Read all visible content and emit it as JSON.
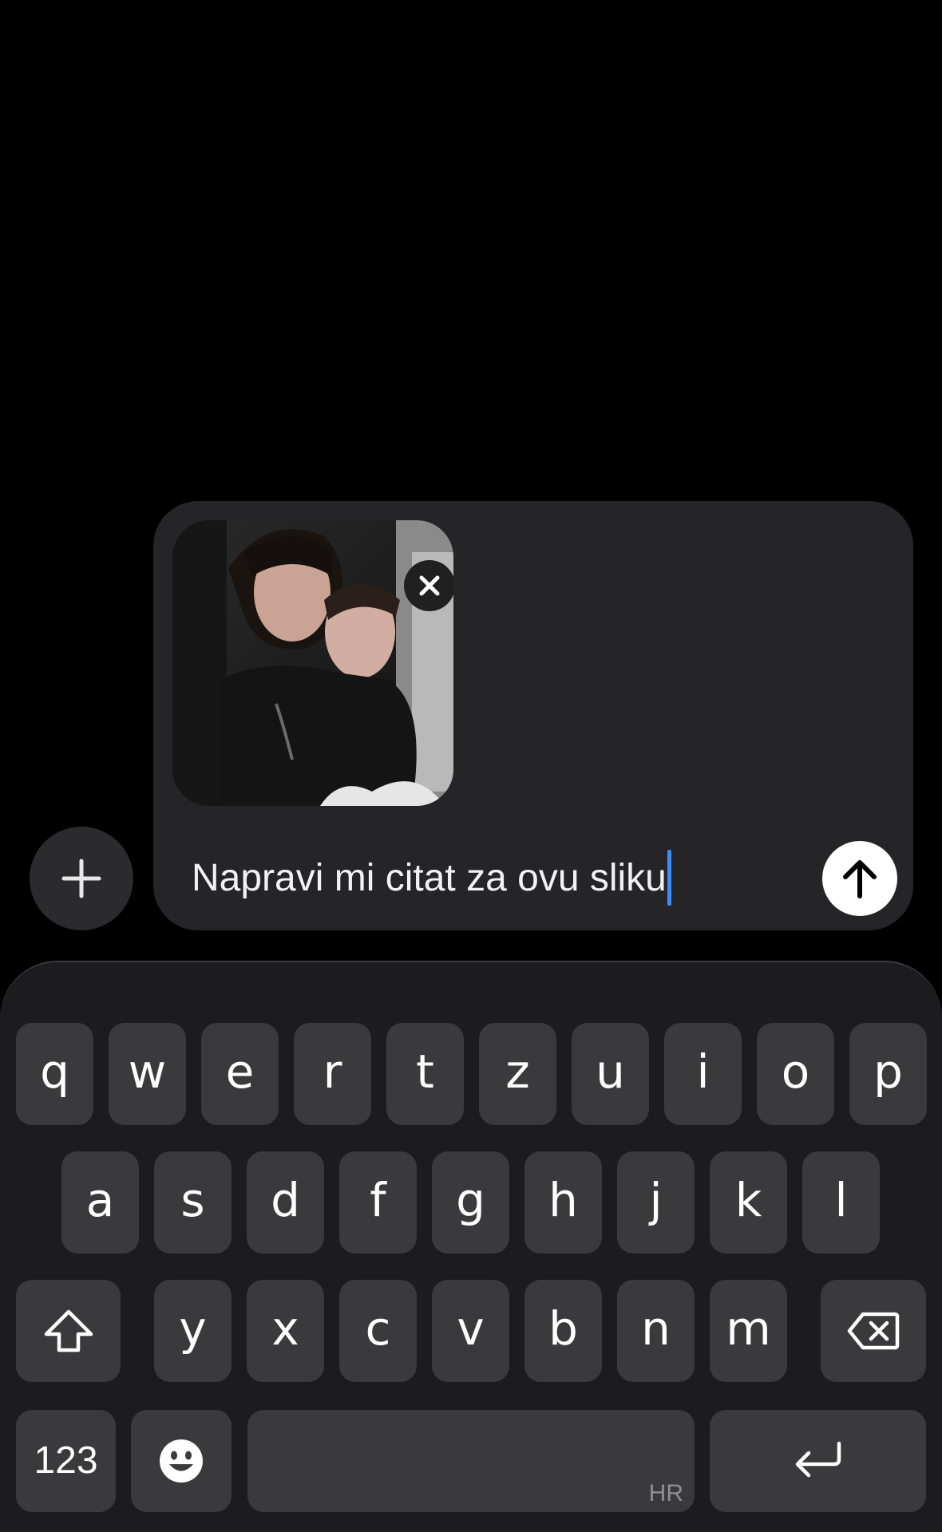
{
  "composer": {
    "message_text": "Napravi mi citat za ovu sliku",
    "attachment_alt": "attached photo"
  },
  "icons": {
    "plus": "plus-icon",
    "remove": "close-icon",
    "send": "arrow-up-icon",
    "shift": "shift-icon",
    "backspace": "backspace-icon",
    "emoji": "emoji-icon",
    "return": "return-icon"
  },
  "keyboard": {
    "row1": [
      "q",
      "w",
      "e",
      "r",
      "t",
      "z",
      "u",
      "i",
      "o",
      "p"
    ],
    "row2": [
      "a",
      "s",
      "d",
      "f",
      "g",
      "h",
      "j",
      "k",
      "l"
    ],
    "row3": [
      "y",
      "x",
      "c",
      "v",
      "b",
      "n",
      "m"
    ],
    "numbers_label": "123",
    "language_label": "HR"
  },
  "colors": {
    "background": "#000000",
    "composer": "#252527",
    "key": "#3a3a3c",
    "caret": "#3a8ef6"
  }
}
